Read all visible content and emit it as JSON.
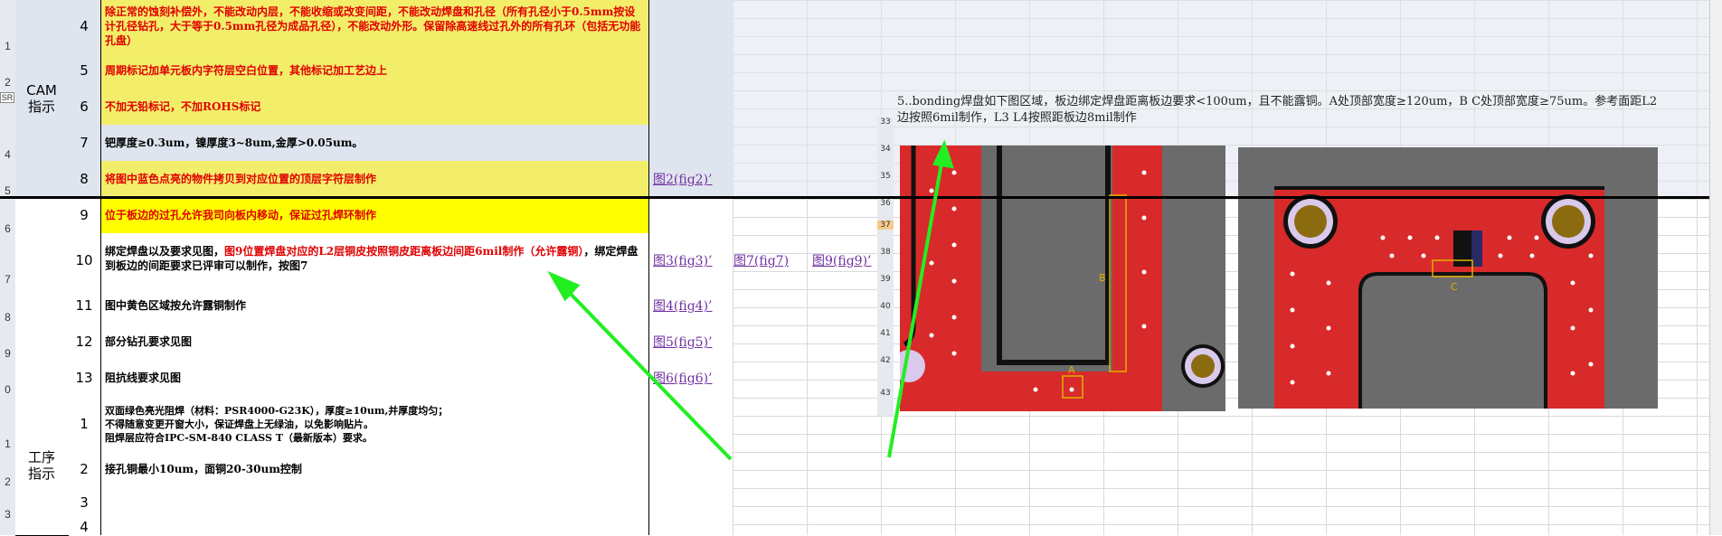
{
  "row_headers": [
    "1",
    "2",
    "3",
    "4",
    "5",
    "6",
    "7",
    "8",
    "9",
    "0",
    "1",
    "2",
    "3"
  ],
  "sections": [
    {
      "label": "CAM\n指示"
    },
    {
      "label": "工序\n指示"
    }
  ],
  "rows": [
    {
      "num": "4",
      "text": "除正常的蚀刻补偿外，不能改动内层，不能收缩或改变间距，不能改动焊盘和孔径（所有孔径小于0.5mm按设计孔径钻孔，大于等于0.5mm孔径为成品孔径），不能改动外形。保留除高速线过孔外的所有孔环（包括无功能孔盘）",
      "ref": ""
    },
    {
      "num": "5",
      "text": "周期标记加单元板内字符层空白位置，其他标记加工艺边上",
      "ref": ""
    },
    {
      "num": "6",
      "text": "不加无铅标记，不加ROHS标记",
      "ref": ""
    },
    {
      "num": "7",
      "text": "钯厚度≥0.3um，镍厚度3~8um,金厚>0.05um。",
      "ref": ""
    },
    {
      "num": "8",
      "text": "将图中蓝色点亮的物件拷贝到对应位置的顶层字符层制作",
      "ref": "图2(fig2)’"
    },
    {
      "num": "9",
      "text": "位于板边的过孔允许我司向板内移动，保证过孔焊环制作",
      "ref": ""
    },
    {
      "num": "10",
      "text_a": "绑定焊盘以及要求见图，",
      "text_b": "图9位置焊盘对应的L2层铜皮按照铜皮距离板边间距6mil制作（允许露铜）",
      "text_c": "，绑定焊盘到板边的间距要求已评审可以制作，按图7",
      "ref": "图3(fig3)’",
      "ref2": "图7(fig7)",
      "ref3": "图9(fig9)’"
    },
    {
      "num": "11",
      "text": "图中黄色区域按允许露铜制作",
      "ref": "图4(fig4)’"
    },
    {
      "num": "12",
      "text": "部分钻孔要求见图",
      "ref": "图5(fig5)’"
    },
    {
      "num": "13",
      "text": "阻抗线要求见图",
      "ref": "图6(fig6)’"
    },
    {
      "num": "1",
      "text": "双面绿色亮光阻焊（材料：PSR4000-G23K），厚度≥10um,并厚度均匀；\n不得随意变更开窗大小，保证焊盘上无绿油，以免影响贴片。\n阻焊层应符合IPC-SM-840 CLASS T（最新版本）要求。",
      "ref": ""
    },
    {
      "num": "2",
      "text": "接孔铜最小10um，面铜20-30um控制",
      "ref": ""
    },
    {
      "num": "3",
      "text": "",
      "ref": ""
    },
    {
      "num": "4",
      "text": "",
      "ref": ""
    }
  ],
  "note": {
    "line1": "5..bonding焊盘如下图区域，板边绑定焊盘距离板边要求<100um，且不能露铜。A处顶部宽度≥120um，B C处顶部宽度≥75um。参考面距L2",
    "line2": "边按照6mil制作，L3 L4按照距板边8mil制作"
  },
  "inner_row_headers": [
    "33",
    "34",
    "35",
    "36",
    "37",
    "38",
    "39",
    "40",
    "41",
    "42",
    "43"
  ],
  "pcb_labels": {
    "a": "A",
    "b": "B",
    "c": "C"
  },
  "sr_label": "SR",
  "colors": {
    "arrow": "#22ee22",
    "pcb_red": "#d82a2a",
    "pcb_gray": "#6b6b6b",
    "ref_purple": "#7030a0"
  }
}
